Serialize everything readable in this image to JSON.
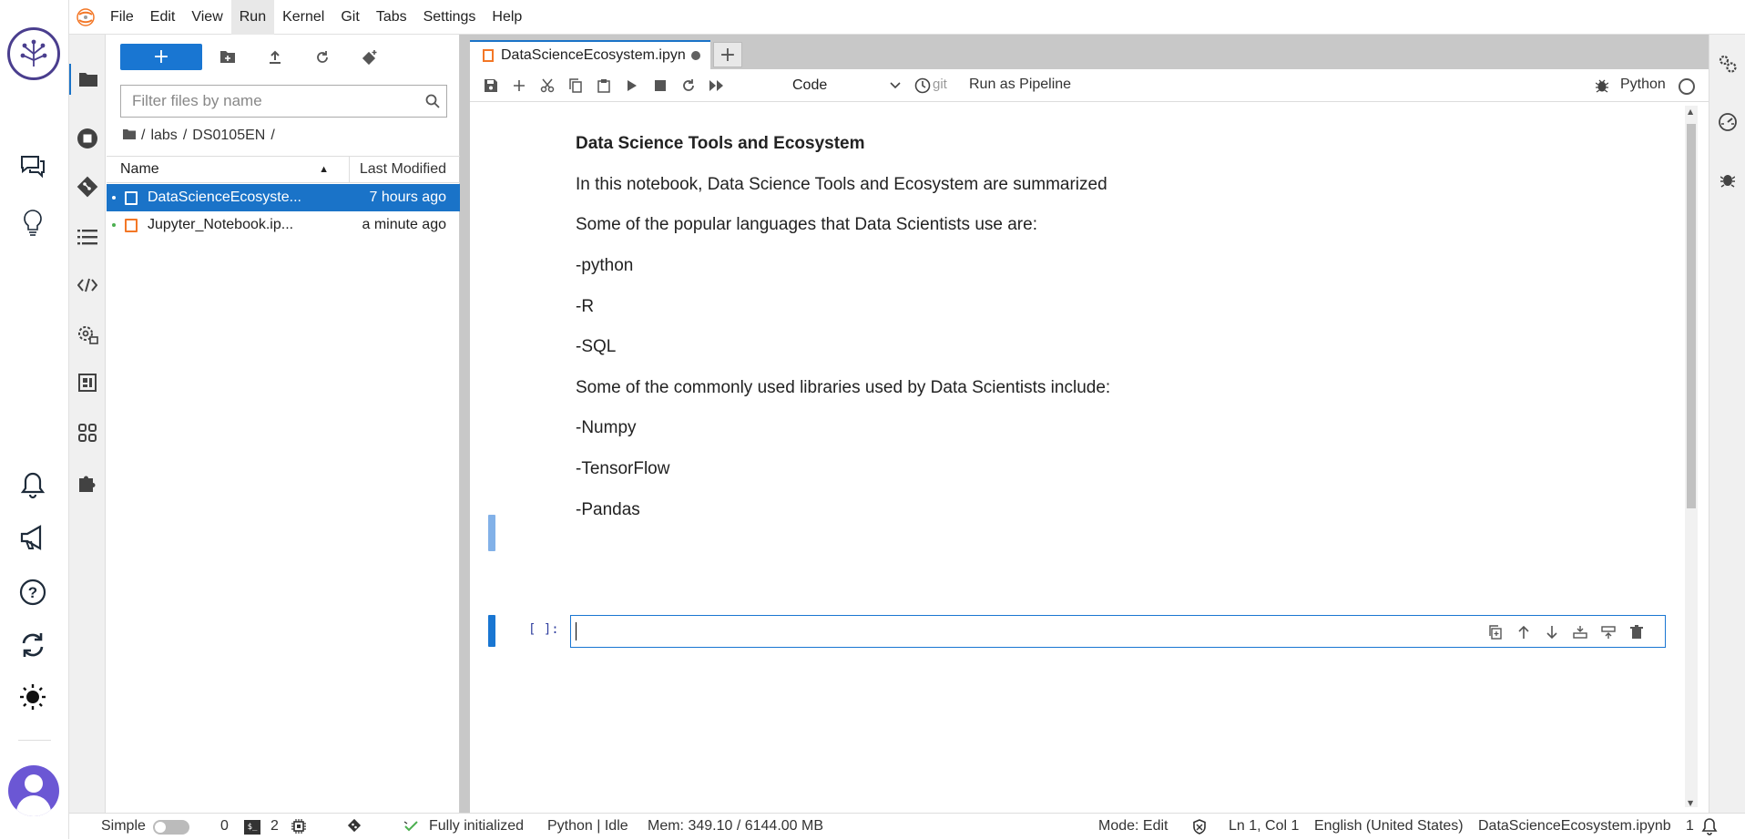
{
  "menubar": {
    "items": [
      "File",
      "Edit",
      "View",
      "Run",
      "Kernel",
      "Git",
      "Tabs",
      "Settings",
      "Help"
    ],
    "active": "Run"
  },
  "filebrowser": {
    "new_label": "+",
    "filter_placeholder": "Filter files by name",
    "breadcrumbs": [
      "/",
      "labs",
      "/",
      "DS0105EN",
      "/"
    ],
    "columns": {
      "name": "Name",
      "modified": "Last Modified"
    },
    "files": [
      {
        "name": "DataScienceEcosyste...",
        "modified": "7 hours ago",
        "selected": true
      },
      {
        "name": "Jupyter_Notebook.ip...",
        "modified": "a minute ago",
        "selected": false
      }
    ]
  },
  "tabs": {
    "doc_title": "DataScienceEcosystem.ipyn",
    "add_label": "+"
  },
  "notebook_toolbar": {
    "cell_type": "Code",
    "git_label": "git",
    "pipeline_label": "Run as Pipeline",
    "kernel": "Python"
  },
  "notebook": {
    "markdown": [
      {
        "text": "Data Science Tools and Ecosystem",
        "heading": true
      },
      {
        "text": "In this notebook, Data Science Tools and Ecosystem are summarized"
      },
      {
        "text": "Some of the popular languages that Data Scientists use are:"
      },
      {
        "text": "-python"
      },
      {
        "text": "-R"
      },
      {
        "text": "-SQL"
      },
      {
        "text": "Some of the commonly used libraries used by Data Scientists include:"
      },
      {
        "text": "-Numpy"
      },
      {
        "text": "-TensorFlow"
      },
      {
        "text": "-Pandas"
      }
    ],
    "code_prompt": "[ ]:",
    "code_value": ""
  },
  "statusbar": {
    "mode_label": "Simple",
    "terminals_count": "0",
    "kernels_count": "2",
    "git_status": "Fully initialized",
    "kernel_status": "Python | Idle",
    "memory": "Mem: 349.10 / 6144.00 MB",
    "mode": "Mode: Edit",
    "cursor": "Ln 1, Col 1",
    "language": "English (United States)",
    "filename": "DataScienceEcosystem.ipynb",
    "notifications": "1"
  },
  "colors": {
    "accent": "#1976d2",
    "notebook_icon": "#f37726",
    "brand": "#4a3e8e"
  }
}
